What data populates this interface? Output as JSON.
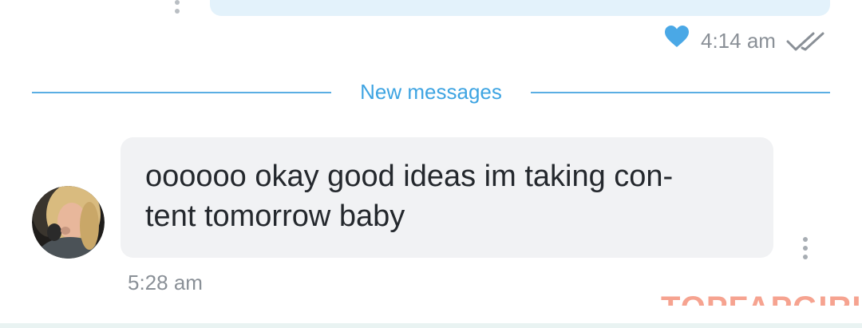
{
  "sent_message": {
    "time": "4:14 am",
    "reaction_icon": "heart-icon",
    "status_icon": "double-check-icon",
    "bubble_color": "#e3f2fb"
  },
  "divider": {
    "label": "New messages",
    "color": "#5aaee3"
  },
  "received_message": {
    "lines": [
      "oooooo okay good ideas im taking con-",
      "tent tomorrow baby"
    ],
    "time": "5:28 am",
    "bubble_color": "#f1f2f4",
    "avatar": "sender-avatar",
    "menu_icon": "more-vertical-icon"
  },
  "watermark": {
    "text": "TOPFAPGIRLS",
    "color": "#f6a390"
  },
  "colors": {
    "accent": "#3ea4e2",
    "timestamp": "#8a9097",
    "heart": "#4aa8e6"
  }
}
